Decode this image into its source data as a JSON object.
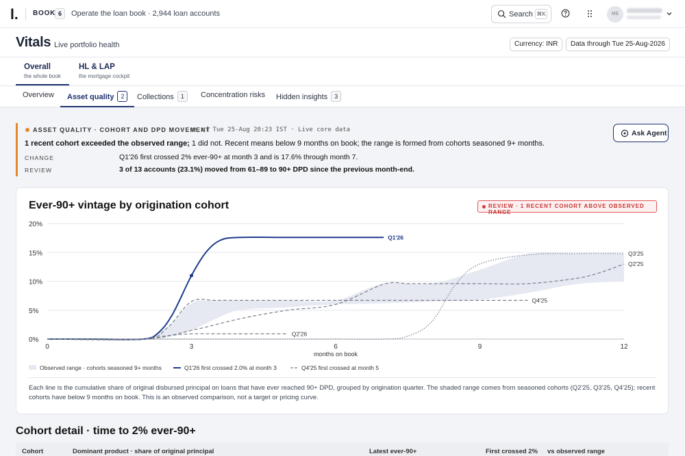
{
  "topbar": {
    "logo": "l.",
    "book_label": "BOOK",
    "book_count": "6",
    "book_desc": "Operate the loan book · 2,944 loan accounts",
    "search_label": "Search",
    "search_shortcut": "⌘K",
    "avatar_initials": "ME",
    "user_name": "ashok",
    "user_role": "super-user"
  },
  "header": {
    "title": "Vitals",
    "subtitle": "Live portfolio health",
    "currency": "Currency: INR",
    "data_through": "Data through Tue 25-Aug-2026"
  },
  "lens_tabs": [
    {
      "title": "Overall",
      "sub": "the whole book"
    },
    {
      "title": "HL & LAP",
      "sub": "the mortgage cockpit"
    }
  ],
  "sub_tabs": [
    {
      "label": "Overview",
      "count": ""
    },
    {
      "label": "Asset quality",
      "count": "2"
    },
    {
      "label": "Collections",
      "count": "1"
    },
    {
      "label": "Concentration risks",
      "count": ""
    },
    {
      "label": "Hidden insights",
      "count": "3"
    }
  ],
  "alert": {
    "label": "ASSET QUALITY · COHORT AND DPD MOVEMENT",
    "meta": "as of Tue 25-Aug 20:23 IST · Live core data",
    "headline_bold": "1 recent cohort exceeded the observed range;",
    "headline_rest": " 1 did not. Recent means below 9 months on book; the range is formed from cohorts seasoned 9+ months.",
    "change_key": "CHANGE",
    "change_val": "Q1'26 first crossed 2% ever-90+ at month 3 and is 17.6% through month 7.",
    "review_key": "REVIEW",
    "review_val": "3 of 13 accounts (23.1%) moved from 61–89 to 90+ DPD since the previous month-end.",
    "ask_label": "Ask Agent"
  },
  "card": {
    "title": "Ever-90+ vintage by origination cohort",
    "badge": "REVIEW · 1 RECENT COHORT ABOVE OBSERVED RANGE",
    "note": "Each line is the cumulative share of original disbursed principal on loans that have ever reached 90+ DPD, grouped by origination quarter. The shaded range comes from seasoned cohorts (Q2'25, Q3'25, Q4'25); recent cohorts have below 9 months on book. This is an observed comparison, not a target or pricing curve."
  },
  "chart_data": {
    "type": "line",
    "title": "Ever-90+ vintage by origination cohort",
    "xlabel": "months on book",
    "ylabel": "",
    "xlim": [
      0,
      12
    ],
    "ylim": [
      0,
      20
    ],
    "x_ticks": [
      0,
      3,
      6,
      9,
      12
    ],
    "y_ticks": [
      0,
      5,
      10,
      15,
      20
    ],
    "y_tick_labels": [
      "0%",
      "5%",
      "10%",
      "15%",
      "20%"
    ],
    "grid": true,
    "colors": {
      "highlight": "#1f3a8a",
      "seasoned": "#7a7f8c",
      "band": "#e6e9f1",
      "alert": "#d23b3b"
    },
    "band": {
      "name": "Observed range · cohorts seasoned 9+ months",
      "x": [
        2,
        2.5,
        3,
        3.5,
        4,
        5,
        6,
        7,
        8,
        9,
        10,
        11,
        12
      ],
      "low": [
        0,
        0.3,
        1.5,
        3.5,
        5,
        5.5,
        6,
        6.2,
        6.5,
        6.8,
        8,
        9.5,
        10
      ],
      "high": [
        0,
        2,
        6.2,
        6.7,
        6.7,
        6.7,
        6.7,
        9.6,
        9.6,
        12,
        14.7,
        14.8,
        14.8
      ]
    },
    "series": [
      {
        "name": "Q1'26",
        "legend": "Q1'26 first crossed 2.0% at month 3",
        "style": "solid",
        "highlight": true,
        "x": [
          0,
          1,
          2,
          2.3,
          2.6,
          3,
          3.3,
          3.6,
          4,
          5,
          6,
          7
        ],
        "y": [
          0,
          0,
          0,
          1,
          4.2,
          11,
          15,
          17.1,
          17.6,
          17.6,
          17.6,
          17.6
        ],
        "marker_x": 3,
        "marker_y": 11
      },
      {
        "name": "Q2'26",
        "legend": "Q4'25 first crossed at month 5",
        "style": "dashed",
        "x": [
          0,
          1,
          2,
          2.5,
          3,
          3.5,
          4,
          4.5,
          5
        ],
        "y": [
          0,
          0,
          0,
          0.6,
          0.9,
          0.9,
          0.9,
          0.9,
          0.9
        ]
      },
      {
        "name": "Q4'25",
        "style": "dashed",
        "x": [
          0,
          2,
          2.5,
          3,
          3.5,
          4,
          5,
          6,
          7,
          8,
          9.5,
          10
        ],
        "y": [
          0,
          0,
          2,
          6.5,
          6.7,
          6.7,
          6.7,
          6.7,
          6.7,
          6.7,
          6.7,
          6.7
        ]
      },
      {
        "name": "Q2'25",
        "style": "dashed",
        "x": [
          0,
          2,
          3,
          4,
          5,
          6,
          7,
          7.5,
          8,
          9,
          10,
          11,
          11.5,
          12
        ],
        "y": [
          0,
          0,
          1.5,
          3.5,
          5,
          6,
          9.5,
          9.6,
          9.6,
          9.6,
          9.6,
          10.5,
          11.5,
          13
        ]
      },
      {
        "name": "Q3'25",
        "style": "dotted",
        "x": [
          0,
          2,
          3,
          4,
          5,
          6,
          7,
          7.5,
          8,
          8.5,
          9,
          10,
          11,
          12
        ],
        "y": [
          0,
          0,
          0,
          0,
          0,
          0,
          0,
          0.5,
          3,
          9.5,
          13,
          14.6,
          14.8,
          14.8
        ]
      }
    ],
    "legend": [
      "Observed range · cohorts seasoned 9+ months",
      "Q1'26 first crossed 2.0% at month 3",
      "Q4'25 first crossed at month 5"
    ]
  },
  "table": {
    "section_title": "Cohort detail · time to 2% ever-90+",
    "headers": [
      "Cohort",
      "Dominant product · share of original principal",
      "Latest ever-90+",
      "First crossed 2%",
      "vs observed range"
    ]
  }
}
